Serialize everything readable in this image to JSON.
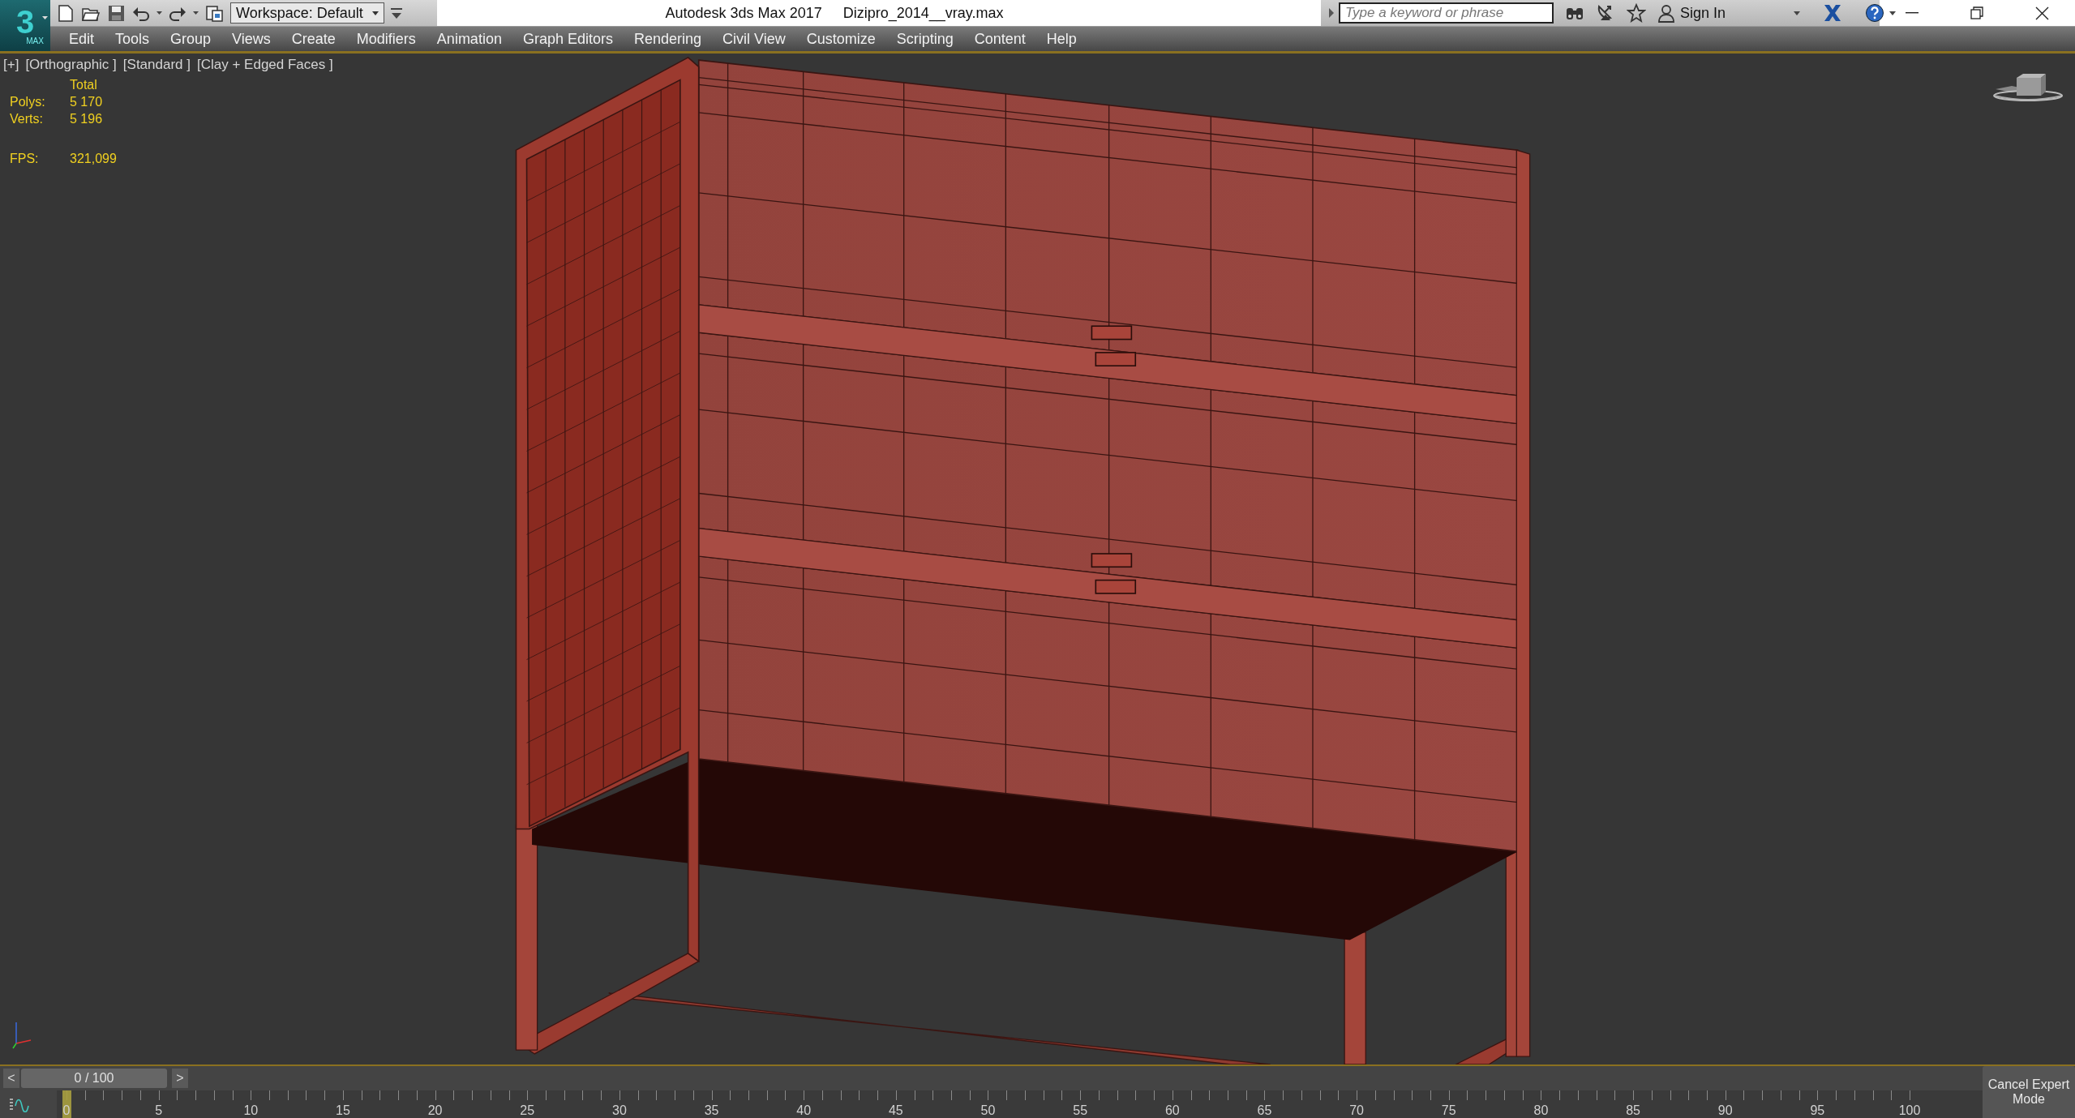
{
  "title_bar": {
    "logo": {
      "numeral": "3",
      "label": "MAX"
    },
    "workspace": "Workspace: Default",
    "app_title": "Autodesk 3ds Max 2017",
    "file_name": "Dizipro_2014__vray.max",
    "search": {
      "placeholder": "Type a keyword or phrase"
    },
    "sign_in": "Sign In"
  },
  "menu": [
    "Edit",
    "Tools",
    "Group",
    "Views",
    "Create",
    "Modifiers",
    "Animation",
    "Graph Editors",
    "Rendering",
    "Civil View",
    "Customize",
    "Scripting",
    "Content",
    "Help"
  ],
  "viewport": {
    "labels": [
      "[+]",
      "[Orthographic ]",
      "[Standard ]",
      "[Clay + Edged Faces ]"
    ],
    "stats": {
      "header": "Total",
      "rows": [
        {
          "kind": "count",
          "label": "Polys:",
          "value": "5 170"
        },
        {
          "kind": "count",
          "label": "Verts:",
          "value": "5 196"
        },
        {
          "kind": "rate",
          "label": "FPS:",
          "value": "321,099"
        }
      ]
    }
  },
  "timeline": {
    "prev": "<",
    "position": "0 / 100",
    "level": 0,
    "next": ">",
    "ticks": [
      "0",
      "5",
      "10",
      "15",
      "20",
      "25",
      "30",
      "35",
      "40",
      "45",
      "50",
      "55",
      "60",
      "65",
      "70",
      "75",
      "80",
      "85",
      "90",
      "95",
      "100"
    ]
  },
  "cancel_expert_mode": "Cancel Expert Mode"
}
